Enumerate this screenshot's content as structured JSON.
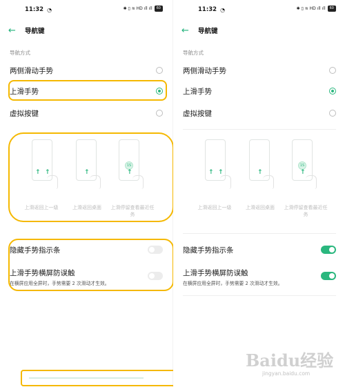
{
  "status": {
    "time": "11:32",
    "extra": "◔",
    "right_icons": "✱ ▯ ≋ HD ıll ıll",
    "battery": "60"
  },
  "nav": {
    "title": "导航键"
  },
  "section_label": "导航方式",
  "options": [
    {
      "label": "两侧滑动手势"
    },
    {
      "label": "上滑手势"
    },
    {
      "label": "虚拟按键"
    }
  ],
  "illustration": {
    "captions": [
      "上滑返回上一级",
      "上滑返回桌面",
      "上滑停留查看最近任务"
    ],
    "hold_text": "1S"
  },
  "toggles": [
    {
      "label": "隐藏手势指示条",
      "desc": ""
    },
    {
      "label": "上滑手势横屏防误触",
      "desc": "在横屏应用全屏时，手势需要 2 次滑动才生效。"
    }
  ],
  "left_state": {
    "selected_option": 1,
    "toggles_on": [
      false,
      false
    ]
  },
  "right_state": {
    "selected_option": 1,
    "toggles_on": [
      true,
      true
    ]
  },
  "watermark": {
    "main": "Baidu经验",
    "sub": "jingyan.baidu.com"
  },
  "colors": {
    "accent": "#2ab77e",
    "highlight": "#f5b800"
  }
}
